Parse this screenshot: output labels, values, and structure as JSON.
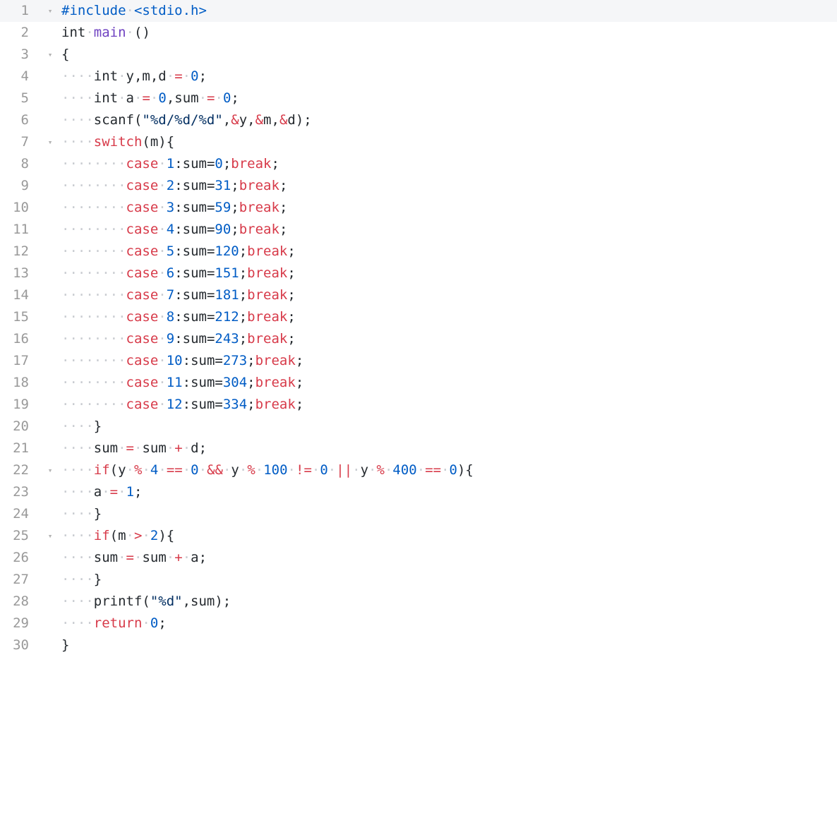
{
  "editor": {
    "fold_icon": "chevron-down-icon",
    "colors": {
      "background": "#ffffff",
      "active_line": "#f5f6f8",
      "gutter_text": "#999999",
      "keyword": "#d73a49",
      "number": "#005cc5",
      "string": "#032f62",
      "function": "#6f42c1",
      "whitespace_dot": "#c9ccd1",
      "text": "#24292e"
    },
    "fold_lines": [
      1,
      3,
      7,
      22,
      25
    ],
    "lines": [
      {
        "number": "1",
        "tokens": [
          [
            "pp",
            "#include"
          ],
          [
            "ws",
            "·"
          ],
          [
            "pp",
            "<stdio.h>"
          ]
        ]
      },
      {
        "number": "2",
        "tokens": [
          [
            "p",
            "int"
          ],
          [
            "ws",
            "·"
          ],
          [
            "fn",
            "main"
          ],
          [
            "ws",
            "·"
          ],
          [
            "p",
            "()"
          ]
        ]
      },
      {
        "number": "3",
        "tokens": [
          [
            "p",
            "{"
          ]
        ]
      },
      {
        "number": "4",
        "tokens": [
          [
            "ws",
            "····"
          ],
          [
            "p",
            "int"
          ],
          [
            "ws",
            "·"
          ],
          [
            "p",
            "y,m,d"
          ],
          [
            "ws",
            "·"
          ],
          [
            "op",
            "="
          ],
          [
            "ws",
            "·"
          ],
          [
            "num",
            "0"
          ],
          [
            "p",
            ";"
          ]
        ]
      },
      {
        "number": "5",
        "tokens": [
          [
            "ws",
            "····"
          ],
          [
            "p",
            "int"
          ],
          [
            "ws",
            "·"
          ],
          [
            "p",
            "a"
          ],
          [
            "ws",
            "·"
          ],
          [
            "op",
            "="
          ],
          [
            "ws",
            "·"
          ],
          [
            "num",
            "0"
          ],
          [
            "p",
            ",sum"
          ],
          [
            "ws",
            "·"
          ],
          [
            "op",
            "="
          ],
          [
            "ws",
            "·"
          ],
          [
            "num",
            "0"
          ],
          [
            "p",
            ";"
          ]
        ]
      },
      {
        "number": "6",
        "tokens": [
          [
            "ws",
            "····"
          ],
          [
            "p",
            "scanf("
          ],
          [
            "str",
            "\"%d/%d/%d\""
          ],
          [
            "p",
            ","
          ],
          [
            "op",
            "&"
          ],
          [
            "p",
            "y,"
          ],
          [
            "op",
            "&"
          ],
          [
            "p",
            "m,"
          ],
          [
            "op",
            "&"
          ],
          [
            "p",
            "d);"
          ]
        ]
      },
      {
        "number": "7",
        "tokens": [
          [
            "ws",
            "····"
          ],
          [
            "kw",
            "switch"
          ],
          [
            "p",
            "(m){"
          ]
        ]
      },
      {
        "number": "8",
        "tokens": [
          [
            "ws",
            "········"
          ],
          [
            "kw",
            "case"
          ],
          [
            "ws",
            "·"
          ],
          [
            "num",
            "1"
          ],
          [
            "p",
            ":sum="
          ],
          [
            "num",
            "0"
          ],
          [
            "p",
            ";"
          ],
          [
            "kw",
            "break"
          ],
          [
            "p",
            ";"
          ]
        ]
      },
      {
        "number": "9",
        "tokens": [
          [
            "ws",
            "········"
          ],
          [
            "kw",
            "case"
          ],
          [
            "ws",
            "·"
          ],
          [
            "num",
            "2"
          ],
          [
            "p",
            ":sum="
          ],
          [
            "num",
            "31"
          ],
          [
            "p",
            ";"
          ],
          [
            "kw",
            "break"
          ],
          [
            "p",
            ";"
          ]
        ]
      },
      {
        "number": "10",
        "tokens": [
          [
            "ws",
            "········"
          ],
          [
            "kw",
            "case"
          ],
          [
            "ws",
            "·"
          ],
          [
            "num",
            "3"
          ],
          [
            "p",
            ":sum="
          ],
          [
            "num",
            "59"
          ],
          [
            "p",
            ";"
          ],
          [
            "kw",
            "break"
          ],
          [
            "p",
            ";"
          ]
        ]
      },
      {
        "number": "11",
        "tokens": [
          [
            "ws",
            "········"
          ],
          [
            "kw",
            "case"
          ],
          [
            "ws",
            "·"
          ],
          [
            "num",
            "4"
          ],
          [
            "p",
            ":sum="
          ],
          [
            "num",
            "90"
          ],
          [
            "p",
            ";"
          ],
          [
            "kw",
            "break"
          ],
          [
            "p",
            ";"
          ]
        ]
      },
      {
        "number": "12",
        "tokens": [
          [
            "ws",
            "········"
          ],
          [
            "kw",
            "case"
          ],
          [
            "ws",
            "·"
          ],
          [
            "num",
            "5"
          ],
          [
            "p",
            ":sum="
          ],
          [
            "num",
            "120"
          ],
          [
            "p",
            ";"
          ],
          [
            "kw",
            "break"
          ],
          [
            "p",
            ";"
          ]
        ]
      },
      {
        "number": "13",
        "tokens": [
          [
            "ws",
            "········"
          ],
          [
            "kw",
            "case"
          ],
          [
            "ws",
            "·"
          ],
          [
            "num",
            "6"
          ],
          [
            "p",
            ":sum="
          ],
          [
            "num",
            "151"
          ],
          [
            "p",
            ";"
          ],
          [
            "kw",
            "break"
          ],
          [
            "p",
            ";"
          ]
        ]
      },
      {
        "number": "14",
        "tokens": [
          [
            "ws",
            "········"
          ],
          [
            "kw",
            "case"
          ],
          [
            "ws",
            "·"
          ],
          [
            "num",
            "7"
          ],
          [
            "p",
            ":sum="
          ],
          [
            "num",
            "181"
          ],
          [
            "p",
            ";"
          ],
          [
            "kw",
            "break"
          ],
          [
            "p",
            ";"
          ]
        ]
      },
      {
        "number": "15",
        "tokens": [
          [
            "ws",
            "········"
          ],
          [
            "kw",
            "case"
          ],
          [
            "ws",
            "·"
          ],
          [
            "num",
            "8"
          ],
          [
            "p",
            ":sum="
          ],
          [
            "num",
            "212"
          ],
          [
            "p",
            ";"
          ],
          [
            "kw",
            "break"
          ],
          [
            "p",
            ";"
          ]
        ]
      },
      {
        "number": "16",
        "tokens": [
          [
            "ws",
            "········"
          ],
          [
            "kw",
            "case"
          ],
          [
            "ws",
            "·"
          ],
          [
            "num",
            "9"
          ],
          [
            "p",
            ":sum="
          ],
          [
            "num",
            "243"
          ],
          [
            "p",
            ";"
          ],
          [
            "kw",
            "break"
          ],
          [
            "p",
            ";"
          ]
        ]
      },
      {
        "number": "17",
        "tokens": [
          [
            "ws",
            "········"
          ],
          [
            "kw",
            "case"
          ],
          [
            "ws",
            "·"
          ],
          [
            "num",
            "10"
          ],
          [
            "p",
            ":sum="
          ],
          [
            "num",
            "273"
          ],
          [
            "p",
            ";"
          ],
          [
            "kw",
            "break"
          ],
          [
            "p",
            ";"
          ]
        ]
      },
      {
        "number": "18",
        "tokens": [
          [
            "ws",
            "········"
          ],
          [
            "kw",
            "case"
          ],
          [
            "ws",
            "·"
          ],
          [
            "num",
            "11"
          ],
          [
            "p",
            ":sum="
          ],
          [
            "num",
            "304"
          ],
          [
            "p",
            ";"
          ],
          [
            "kw",
            "break"
          ],
          [
            "p",
            ";"
          ]
        ]
      },
      {
        "number": "19",
        "tokens": [
          [
            "ws",
            "········"
          ],
          [
            "kw",
            "case"
          ],
          [
            "ws",
            "·"
          ],
          [
            "num",
            "12"
          ],
          [
            "p",
            ":sum="
          ],
          [
            "num",
            "334"
          ],
          [
            "p",
            ";"
          ],
          [
            "kw",
            "break"
          ],
          [
            "p",
            ";"
          ]
        ]
      },
      {
        "number": "20",
        "tokens": [
          [
            "ws",
            "····"
          ],
          [
            "p",
            "}"
          ]
        ]
      },
      {
        "number": "21",
        "tokens": [
          [
            "ws",
            "····"
          ],
          [
            "p",
            "sum"
          ],
          [
            "ws",
            "·"
          ],
          [
            "op",
            "="
          ],
          [
            "ws",
            "·"
          ],
          [
            "p",
            "sum"
          ],
          [
            "ws",
            "·"
          ],
          [
            "op",
            "+"
          ],
          [
            "ws",
            "·"
          ],
          [
            "p",
            "d;"
          ]
        ]
      },
      {
        "number": "22",
        "tokens": [
          [
            "ws",
            "····"
          ],
          [
            "kw",
            "if"
          ],
          [
            "p",
            "(y"
          ],
          [
            "ws",
            "·"
          ],
          [
            "op",
            "%"
          ],
          [
            "ws",
            "·"
          ],
          [
            "num",
            "4"
          ],
          [
            "ws",
            "·"
          ],
          [
            "op",
            "=="
          ],
          [
            "ws",
            "·"
          ],
          [
            "num",
            "0"
          ],
          [
            "ws",
            "·"
          ],
          [
            "op",
            "&&"
          ],
          [
            "ws",
            "·"
          ],
          [
            "p",
            "y"
          ],
          [
            "ws",
            "·"
          ],
          [
            "op",
            "%"
          ],
          [
            "ws",
            "·"
          ],
          [
            "num",
            "100"
          ],
          [
            "ws",
            "·"
          ],
          [
            "op",
            "!="
          ],
          [
            "ws",
            "·"
          ],
          [
            "num",
            "0"
          ],
          [
            "ws",
            "·"
          ],
          [
            "op",
            "||"
          ],
          [
            "ws",
            "·"
          ],
          [
            "p",
            "y"
          ],
          [
            "ws",
            "·"
          ],
          [
            "op",
            "%"
          ],
          [
            "ws",
            "·"
          ],
          [
            "num",
            "400"
          ],
          [
            "ws",
            "·"
          ],
          [
            "op",
            "=="
          ],
          [
            "ws",
            "·"
          ],
          [
            "num",
            "0"
          ],
          [
            "p",
            "){"
          ]
        ]
      },
      {
        "number": "23",
        "tokens": [
          [
            "ws",
            "····"
          ],
          [
            "p",
            "a"
          ],
          [
            "ws",
            "·"
          ],
          [
            "op",
            "="
          ],
          [
            "ws",
            "·"
          ],
          [
            "num",
            "1"
          ],
          [
            "p",
            ";"
          ]
        ]
      },
      {
        "number": "24",
        "tokens": [
          [
            "ws",
            "····"
          ],
          [
            "p",
            "}"
          ]
        ]
      },
      {
        "number": "25",
        "tokens": [
          [
            "ws",
            "····"
          ],
          [
            "kw",
            "if"
          ],
          [
            "p",
            "(m"
          ],
          [
            "ws",
            "·"
          ],
          [
            "op",
            ">"
          ],
          [
            "ws",
            "·"
          ],
          [
            "num",
            "2"
          ],
          [
            "p",
            "){"
          ]
        ]
      },
      {
        "number": "26",
        "tokens": [
          [
            "ws",
            "····"
          ],
          [
            "p",
            "sum"
          ],
          [
            "ws",
            "·"
          ],
          [
            "op",
            "="
          ],
          [
            "ws",
            "·"
          ],
          [
            "p",
            "sum"
          ],
          [
            "ws",
            "·"
          ],
          [
            "op",
            "+"
          ],
          [
            "ws",
            "·"
          ],
          [
            "p",
            "a;"
          ]
        ]
      },
      {
        "number": "27",
        "tokens": [
          [
            "ws",
            "····"
          ],
          [
            "p",
            "}"
          ]
        ]
      },
      {
        "number": "28",
        "tokens": [
          [
            "ws",
            "····"
          ],
          [
            "p",
            "printf("
          ],
          [
            "str",
            "\"%d\""
          ],
          [
            "p",
            ",sum);"
          ]
        ]
      },
      {
        "number": "29",
        "tokens": [
          [
            "ws",
            "····"
          ],
          [
            "kw",
            "return"
          ],
          [
            "ws",
            "·"
          ],
          [
            "num",
            "0"
          ],
          [
            "p",
            ";"
          ]
        ]
      },
      {
        "number": "30",
        "tokens": [
          [
            "p",
            "}"
          ]
        ]
      }
    ]
  }
}
